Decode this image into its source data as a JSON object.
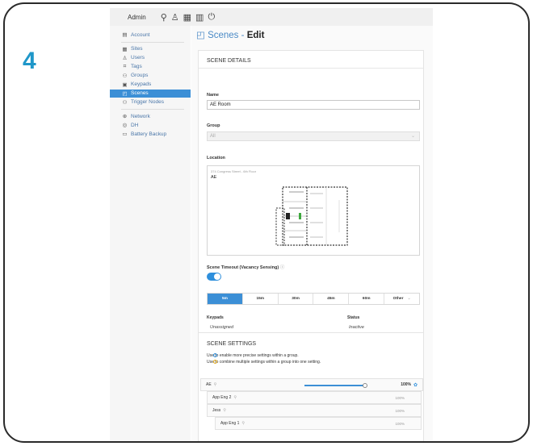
{
  "step": "4",
  "topbar": {
    "user": "Admin",
    "icons": [
      "location-pin-icon",
      "user-icon",
      "grid-icon",
      "chart-icon",
      "plug-icon"
    ]
  },
  "sidebar": {
    "items": [
      {
        "label": "Account",
        "icon": "account-icon",
        "glyph": "▤"
      },
      {
        "label": "Sites",
        "icon": "building-icon",
        "glyph": "▦"
      },
      {
        "label": "Users",
        "icon": "users-icon",
        "glyph": "♙"
      },
      {
        "label": "Tags",
        "icon": "tag-icon",
        "glyph": "⌗"
      },
      {
        "label": "Groups",
        "icon": "groups-icon",
        "glyph": "⚇"
      },
      {
        "label": "Keypads",
        "icon": "keypad-icon",
        "glyph": "▣"
      },
      {
        "label": "Scenes",
        "icon": "scene-icon",
        "glyph": "◰",
        "active": true
      },
      {
        "label": "Trigger Nodes",
        "icon": "trigger-icon",
        "glyph": "⚇"
      },
      {
        "label": "Network",
        "icon": "network-icon",
        "glyph": "⊕"
      },
      {
        "label": "DH",
        "icon": "dh-icon",
        "glyph": "◎"
      },
      {
        "label": "Battery Backup",
        "icon": "battery-icon",
        "glyph": "▭"
      }
    ]
  },
  "page": {
    "title": "Scenes",
    "separator": "-",
    "title_suffix": "Edit"
  },
  "details": {
    "heading": "SCENE DETAILS",
    "name_label": "Name",
    "name_value": "AE Room",
    "group_label": "Group",
    "group_value": "All",
    "location_label": "Location",
    "location_address": "374 Congress Street - 6th Floor",
    "location_name": "AE",
    "timeout_label": "Scene Timeout (Vacancy Sensing)",
    "timeout_options": [
      "5m",
      "15m",
      "30m",
      "45m",
      "60m",
      "Other"
    ],
    "timeout_selected": "5m",
    "keypads_label": "Keypads",
    "keypads_value": "Unassigned",
    "status_label": "Status",
    "status_value": "Inactive"
  },
  "settings": {
    "heading": "SCENE SETTINGS",
    "help1": "Use   to enable more precise settings within a group.",
    "help2": "Use   to combine multiple settings within a group into one setting.",
    "rows": [
      {
        "name": "AE",
        "level": "100%",
        "value": 1.0
      },
      {
        "name": "App Eng 2",
        "level": "100%"
      },
      {
        "name": "Jess",
        "level": "100%"
      },
      {
        "name": "App Eng 1",
        "level": "100%"
      }
    ]
  },
  "colors": {
    "accent": "#3c8fd6",
    "step": "#1f97c9",
    "link": "#4a76a8"
  }
}
